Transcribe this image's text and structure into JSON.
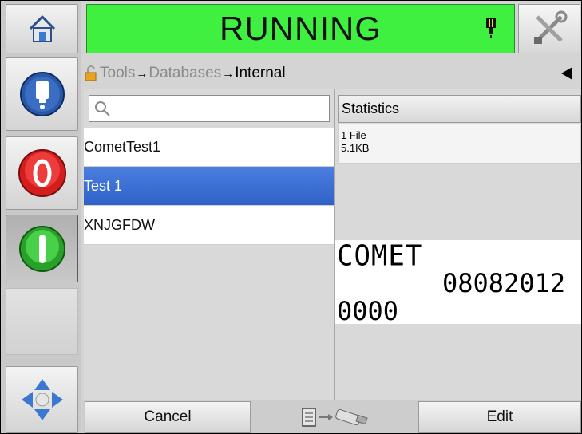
{
  "status": {
    "text": "RUNNING",
    "color": "#40f040"
  },
  "breadcrumb": {
    "tools": "Tools",
    "databases": "Databases",
    "internal": "Internal",
    "sep": "→"
  },
  "search": {
    "placeholder": ""
  },
  "files": [
    {
      "name": "CometTest1",
      "selected": false
    },
    {
      "name": "Test 1",
      "selected": true
    },
    {
      "name": "XNJGFDW",
      "selected": false
    }
  ],
  "statistics": {
    "header": "Statistics",
    "file_count": "1 File",
    "size": "5.1KB"
  },
  "preview": {
    "line1": "COMET",
    "line2": "08082012",
    "line3": "0000"
  },
  "bottom": {
    "cancel": "Cancel",
    "edit": "Edit"
  },
  "icons": {
    "home": "home-icon",
    "ink": "ink-bottle-icon",
    "stop": "stop-icon",
    "start": "start-icon",
    "nav": "navigation-arrows-icon",
    "tools": "tools-icon",
    "lock": "lock-icon",
    "alert": "printhead-status-icon",
    "transfer": "database-to-usb-icon"
  }
}
